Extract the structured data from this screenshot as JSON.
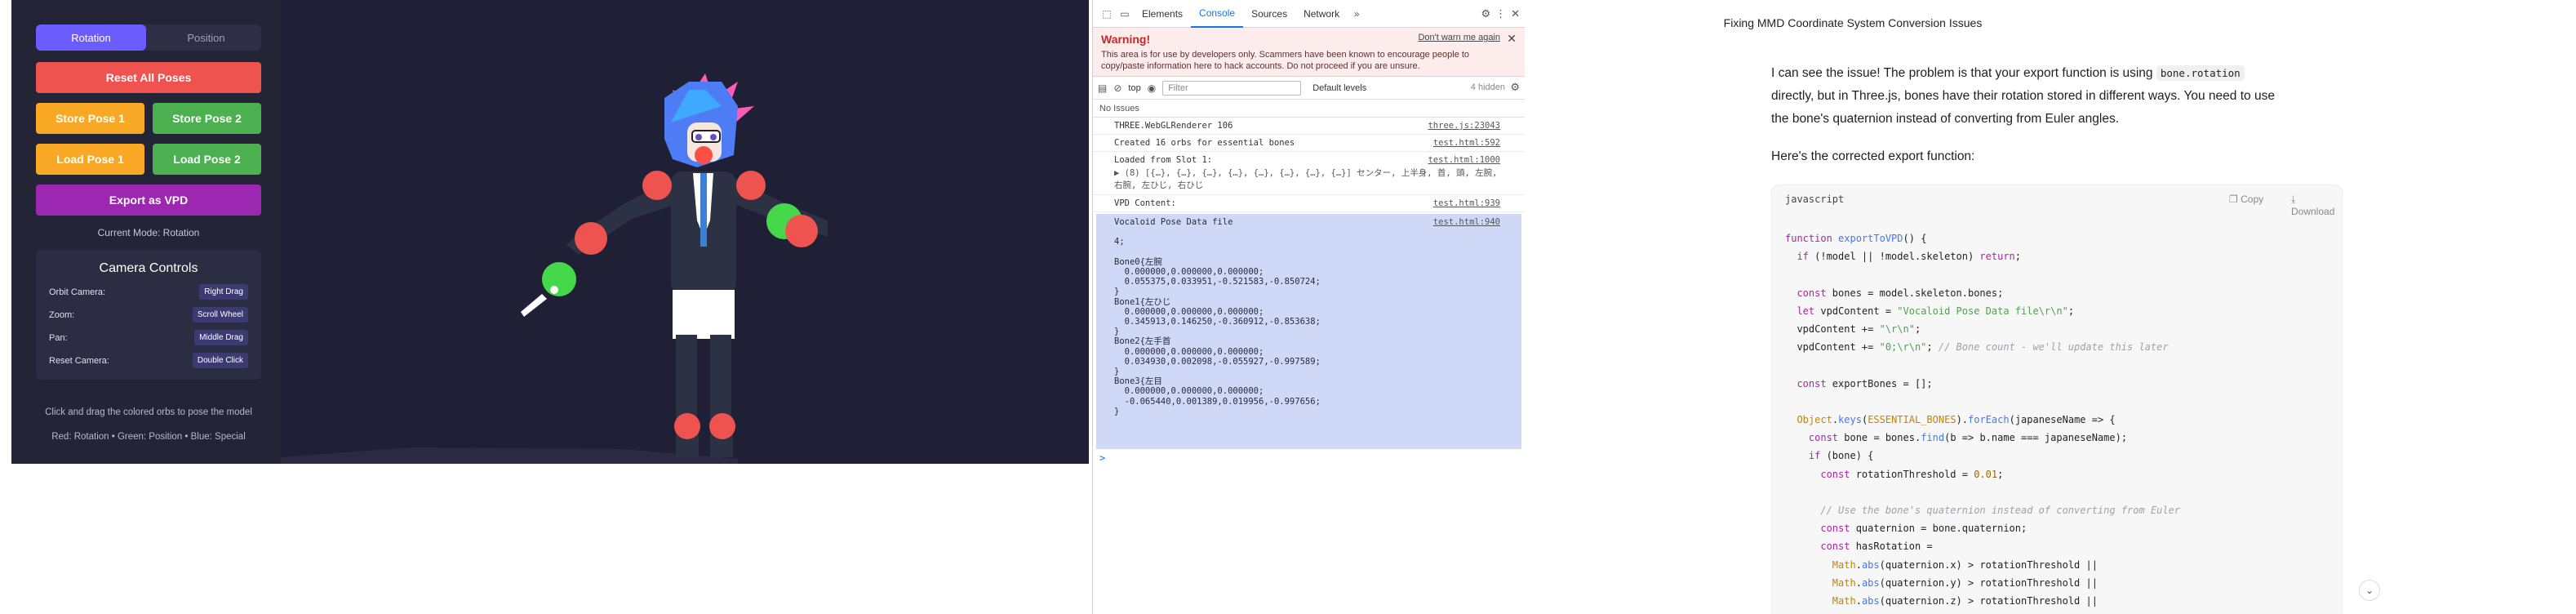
{
  "app": {
    "mode_tabs": [
      {
        "label": "Rotation",
        "active": true
      },
      {
        "label": "Position",
        "active": false
      }
    ],
    "buttons": {
      "reset": "Reset All Poses",
      "store1": "Store Pose 1",
      "store2": "Store Pose 2",
      "load1": "Load Pose 1",
      "load2": "Load Pose 2",
      "export": "Export as VPD"
    },
    "current_mode": "Current Mode: Rotation",
    "camera": {
      "title": "Camera Controls",
      "rows": [
        {
          "label": "Orbit Camera:",
          "key": "Right Drag"
        },
        {
          "label": "Zoom:",
          "key": "Scroll Wheel"
        },
        {
          "label": "Pan:",
          "key": "Middle Drag"
        },
        {
          "label": "Reset Camera:",
          "key": "Double Click"
        }
      ]
    },
    "hint1": "Click and drag the colored orbs to pose the model",
    "hint2": "Red: Rotation • Green: Position • Blue: Special",
    "colors": {
      "accent": "#6a5cff",
      "red": "#ef5350",
      "orange": "#f9a825",
      "green": "#4caf50",
      "purple": "#9c27b0"
    }
  },
  "devtools": {
    "tabs": [
      "Elements",
      "Console",
      "Sources",
      "Network"
    ],
    "active_tab": "Console",
    "warning": {
      "title": "Warning!",
      "link": "Don't warn me again",
      "text": "This area is for use by developers only. Scammers have been known to encourage people to copy/paste information here to hack accounts. Do not proceed if you are unsure."
    },
    "context": "top",
    "filter_placeholder": "Filter",
    "levels": "Default levels",
    "hidden": "4 hidden",
    "issues": "No Issues",
    "logs": [
      {
        "text": "THREE.WebGLRenderer 106",
        "src": "three.js:23043",
        "sub": ""
      },
      {
        "text": "Created 16 orbs for essential bones",
        "src": "test.html:592",
        "sub": ""
      },
      {
        "text": "Loaded from Slot 1:",
        "src": "test.html:1000",
        "sub": "▶ (8) [{…}, {…}, {…}, {…}, {…}, {…}, {…}, {…}] センター, 上半身, 首, 頭, 左腕, 右腕, 左ひじ, 右ひじ"
      },
      {
        "text": "VPD Content:",
        "src": "test.html:939",
        "sub": ""
      }
    ],
    "vpd": {
      "src": "test.html:940",
      "content": "Vocaloid Pose Data file\n\n4;\n\nBone0{左腕\n  0.000000,0.000000,0.000000;\n  0.055375,0.033951,-0.521583,-0.850724;\n}\nBone1{左ひじ\n  0.000000,0.000000,0.000000;\n  0.345913,0.146250,-0.360912,-0.853638;\n}\nBone2{左手首\n  0.000000,0.000000,0.000000;\n  0.034930,0.002098,-0.055927,-0.997589;\n}\nBone3{左目\n  0.000000,0.000000,0.000000;\n  -0.065440,0.001389,0.019956,-0.997656;\n}"
    },
    "prompt": ">"
  },
  "chat": {
    "title": "Fixing MMD Coordinate System Conversion Issues",
    "p1_a": "I can see the issue! The problem is that your export function is using ",
    "p1_code": "bone.rotation",
    "p1_b": " directly, but in Three.js, bones have their rotation stored in different ways. You need to use the bone's quaternion instead of converting from Euler angles.",
    "p2": "Here's the corrected export function:",
    "code_lang": "javascript",
    "copy": "Copy",
    "download": "Download"
  }
}
